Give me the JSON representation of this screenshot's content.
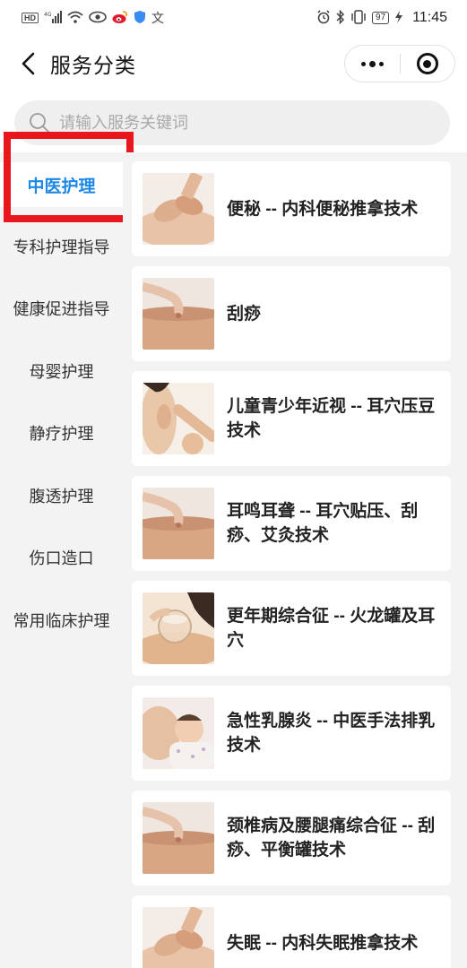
{
  "status_bar": {
    "left_icons": [
      "hd-icon",
      "signal-4g-icon",
      "wifi-icon",
      "eye-icon",
      "weibo-icon",
      "shield-icon",
      "translate-icon"
    ],
    "right_icons": [
      "alarm-icon",
      "bluetooth-icon",
      "vibrate-icon"
    ],
    "battery": "97",
    "time": "11:45"
  },
  "nav": {
    "title": "服务分类"
  },
  "search": {
    "placeholder": "请输入服务关键词"
  },
  "sidebar": {
    "items": [
      {
        "label": "中医护理",
        "active": true
      },
      {
        "label": "专科护理指导",
        "active": false
      },
      {
        "label": "健康促进指导",
        "active": false
      },
      {
        "label": "母婴护理",
        "active": false
      },
      {
        "label": "静疗护理",
        "active": false
      },
      {
        "label": "腹透护理",
        "active": false
      },
      {
        "label": "伤口造口",
        "active": false
      },
      {
        "label": "常用临床护理",
        "active": false
      }
    ]
  },
  "services": [
    {
      "title": "便秘 -- 内科便秘推拿技术",
      "image": "massage-abdomen-photo"
    },
    {
      "title": "刮痧",
      "image": "scraping-back-photo"
    },
    {
      "title": "儿童青少年近视 -- 耳穴压豆技术",
      "image": "ear-acupressure-photo"
    },
    {
      "title": "耳鸣耳聋 -- 耳穴贴压、刮痧、艾灸技术",
      "image": "scraping-back-photo"
    },
    {
      "title": "更年期综合征 -- 火龙罐及耳穴",
      "image": "cupping-photo"
    },
    {
      "title": "急性乳腺炎 -- 中医手法排乳技术",
      "image": "breastfeeding-photo"
    },
    {
      "title": "颈椎病及腰腿痛综合征 -- 刮痧、平衡罐技术",
      "image": "scraping-back-photo"
    },
    {
      "title": "失眠 -- 内科失眠推拿技术",
      "image": "massage-abdomen-photo"
    }
  ],
  "colors": {
    "accent": "#1e88e5",
    "highlight": "#e8161d",
    "background": "#f3f3f3"
  }
}
